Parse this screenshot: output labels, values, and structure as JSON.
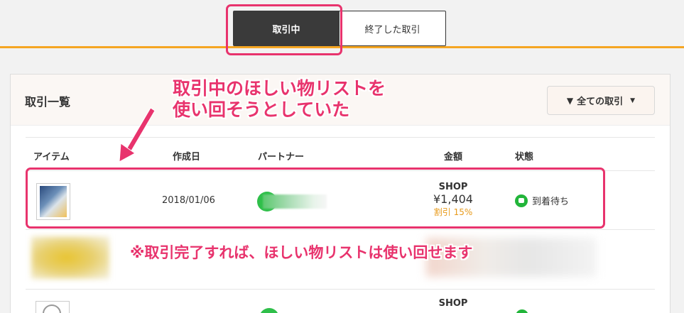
{
  "tabs": {
    "active": "取引中",
    "inactive": "終了した取引"
  },
  "panel": {
    "title": "取引一覧",
    "filter_label": "全ての取引"
  },
  "columns": [
    "アイテム",
    "作成日",
    "パートナー",
    "金額",
    "状態"
  ],
  "rows": [
    {
      "date": "2018/01/06",
      "shop": "SHOP",
      "price": "¥1,404",
      "discount": "割引 15%",
      "status": "到着待ち"
    },
    {
      "shop": "SHOP"
    }
  ],
  "annotations": {
    "note1_line1": "取引中のほしい物リストを",
    "note1_line2": "使い回そうとしていた",
    "note2": "※取引完了すれば、ほしい物リストは使い回せます"
  },
  "colors": {
    "accent": "#e8336d",
    "brand": "#f5a623",
    "status": "#22b53a"
  },
  "icons": [
    "funnel-icon",
    "caret-down-icon",
    "status-icon",
    "arrow-icon"
  ]
}
